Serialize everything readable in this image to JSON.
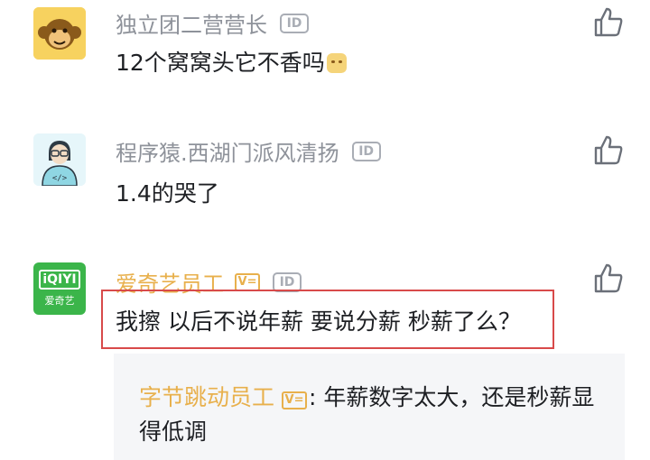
{
  "comments": [
    {
      "username": "独立团二营营长",
      "id_badge": "ID",
      "text": "12个窝窝头它不香吗",
      "emoji": "smiling-face-emoji",
      "avatar": "monkey-avatar"
    },
    {
      "username": "程序猿.西湖门派风清扬",
      "id_badge": "ID",
      "text": "1.4的哭了",
      "avatar": "programmer-avatar"
    },
    {
      "username": "爱奇艺员工",
      "v_badge": "V=",
      "id_badge": "ID",
      "text": "我擦 以后不说年薪 要说分薪 秒薪了么？",
      "avatar": "iqiyi-logo-avatar",
      "avatar_caption": "爱奇艺",
      "avatar_logo_text": "iQIYI",
      "highlighted": true,
      "reply": {
        "username": "字节跳动员工",
        "v_badge": "V=",
        "separator": ":",
        "text": " 年薪数字太大，还是秒薪显得低调"
      }
    }
  ],
  "colors": {
    "username_gray": "#8e929a",
    "vip_gold": "#e8b04c",
    "text": "#1d1f23",
    "highlight_red": "#d84a4a",
    "reply_bg": "#f5f6f8",
    "iqiyi_green": "#3bb54a"
  }
}
